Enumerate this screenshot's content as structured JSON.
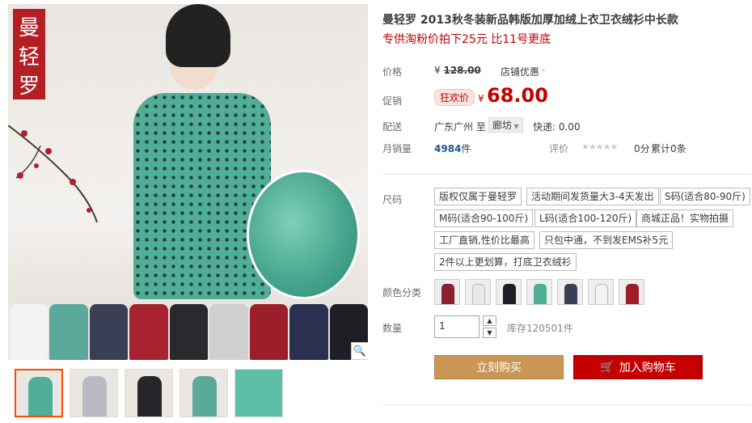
{
  "brand_logo_text": "曼轻罗",
  "product": {
    "title": "曼轻罗 2013秋冬装新品韩版加厚加绒上衣卫衣绒衫中长款",
    "subtitle": "专供淘粉价拍下25元 比11号更底"
  },
  "price": {
    "label": "价格",
    "currency": "¥",
    "original": "128.00",
    "shop_coupon": "店铺优惠"
  },
  "promo": {
    "label": "促销",
    "tag": "狂欢价",
    "currency": "¥",
    "value": "68.00"
  },
  "delivery": {
    "label": "配送",
    "origin": "广东广州",
    "to": "至",
    "destination": "廊坊",
    "shipping": "快递: 0.00"
  },
  "sales": {
    "label": "月销量",
    "count": "4984",
    "unit": "件",
    "rating_label": "评价",
    "score": "0分",
    "cumulative": "累计0条"
  },
  "size": {
    "label": "尺码",
    "options": [
      "版权仅属于曼轻罗",
      "活动期间发货量大3-4天发出",
      "S码(适合80-90斤)",
      "M码(适合90-100斤)",
      "L码(适合100-120斤)",
      "商城正品！实物拍摄",
      "工厂直销,性价比最高",
      "只包中通，不到发EMS补5元",
      "2件以上更划算，打底卫衣绒衫"
    ]
  },
  "color": {
    "label": "颜色分类",
    "swatches": [
      "#8c2030",
      "#e8e8e8",
      "#1e1e24",
      "#4fae95",
      "#3a3f55",
      "#f2f2f2",
      "#9c1e2a"
    ]
  },
  "quantity": {
    "label": "数量",
    "value": "1",
    "stock": "库存120501件"
  },
  "buttons": {
    "buy": "立刻购买",
    "cart": "加入购物车"
  },
  "gallery": {
    "tees": [
      "#f2f2f2",
      "#5aa99a",
      "#3a3f55",
      "#a8222f",
      "#2a2a2e",
      "#cfcfcf",
      "#9c1e2a",
      "#2c3050",
      "#1e1e24"
    ],
    "thumbs": [
      "#4fae95",
      "#b9b9c4",
      "#26262b",
      "#5aa99a",
      "#5fbea6"
    ]
  },
  "colors": {
    "accent_red": "#c40000",
    "buy_button": "#c99656",
    "brand_red": "#b41f24"
  }
}
